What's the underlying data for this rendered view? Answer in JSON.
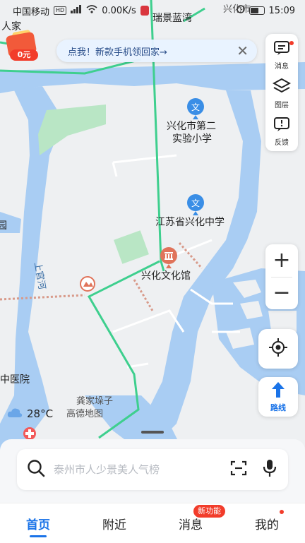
{
  "status_bar": {
    "carrier": "中国移动",
    "hd": "HD",
    "net_speed": "0.00K/s",
    "time": "15:09"
  },
  "promo_banner": {
    "text": "点我！新款手机领回家→"
  },
  "red_packet": {
    "label": "0元"
  },
  "map_labels": {
    "top_fragment": "人家",
    "top_area": "瑞景蓝湾",
    "top_right": "兴化市",
    "school_2": "兴化市第二",
    "school_2_line2": "实验小学",
    "middle_school": "江苏省兴化中学",
    "culture_hall": "兴化文化馆",
    "river": "上官河",
    "hospital": "中医院",
    "left_fragment": "园",
    "bottom_area": "龚家垛子",
    "map_brand": "高德地图"
  },
  "right_panel": {
    "messages": "消息",
    "layers": "图层",
    "feedback": "反馈"
  },
  "route_button": {
    "label": "路线"
  },
  "weather": {
    "temperature": "28°C"
  },
  "search": {
    "placeholder": "泰州市人少景美人气榜"
  },
  "tabs": [
    {
      "label": "首页"
    },
    {
      "label": "附近"
    },
    {
      "label": "消息"
    },
    {
      "label": "我的"
    }
  ],
  "new_feature_badge": "新功能",
  "colors": {
    "water": "#a9cdf3",
    "road": "#ffffff",
    "transit_line": "#3ecf8e",
    "accent": "#1a73e8",
    "poi_school": "#3a8ee6",
    "poi_culture": "#e0735a",
    "park": "#b9e6c5"
  }
}
